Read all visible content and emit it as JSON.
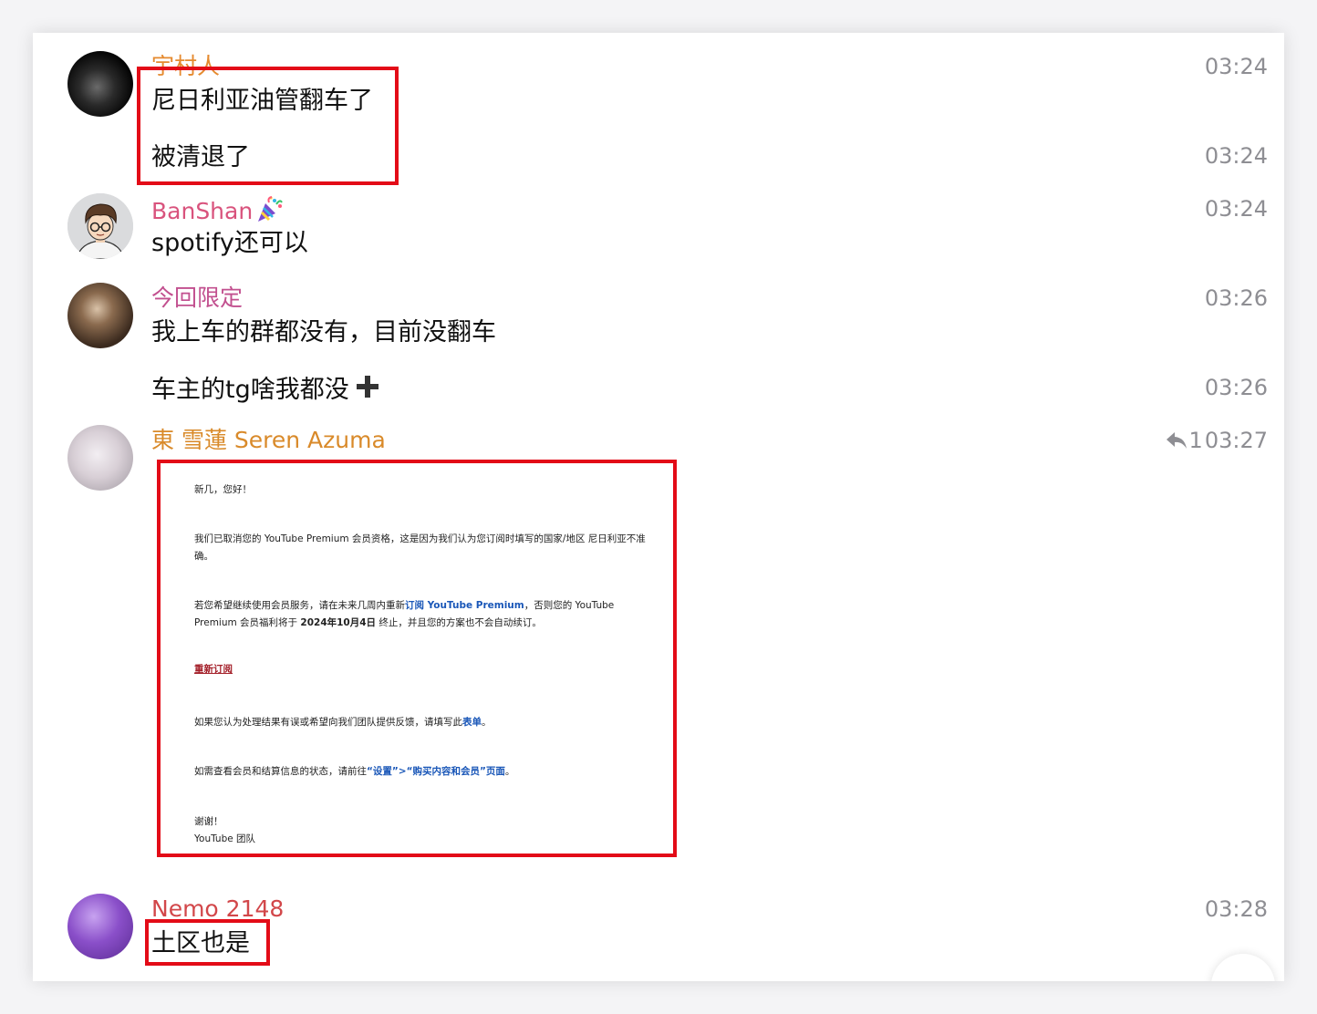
{
  "messages": [
    {
      "sender": "宇村人",
      "sender_color": "#e58a2f",
      "lines": [
        {
          "text": "尼日利亚油管翻车了",
          "time": "03:24"
        },
        {
          "text": "被清退了",
          "time": "03:24"
        }
      ]
    },
    {
      "sender": "BanShan",
      "sender_color": "#d9537d",
      "lines": [
        {
          "text": "spotify还可以",
          "time": "03:24"
        }
      ]
    },
    {
      "sender": "今回限定",
      "sender_color": "#c2508f",
      "lines": [
        {
          "text": "我上车的群都没有，目前没翻车",
          "time": "03:26"
        },
        {
          "text": "车主的tg啥我都没",
          "time": "03:26"
        }
      ]
    },
    {
      "sender": "東 雪蓮 Seren Azuma",
      "sender_color": "#d98a2a",
      "time": "03:27",
      "reply_count": "1",
      "email": {
        "greeting": "新几，您好！",
        "p1": "我们已取消您的 YouTube Premium 会员资格，这是因为我们认为您订阅时填写的国家/地区 尼日利亚不准确。",
        "p2_a": "若您希望继续使用会员服务，请在未来几周内重新",
        "p2_link": "订阅 YouTube Premium",
        "p2_b": "，否则您的 YouTube Premium 会员福利将于 ",
        "p2_date": "2024年10月4日",
        "p2_c": " 终止，并且您的方案也不会自动续订。",
        "resubscribe": "重新订阅",
        "p3_a": "如果您认为处理结果有误或希望向我们团队提供反馈，请填写此",
        "p3_link": "表单",
        "p3_b": "。",
        "p4_a": "如需查看会员和结算信息的状态，请前往",
        "p4_link": "“设置”>“购买内容和会员”页面",
        "p4_b": "。",
        "thanks": "谢谢！",
        "signature": "YouTube 团队"
      }
    },
    {
      "sender": "Nemo 2148",
      "sender_color": "#d2474a",
      "lines": [
        {
          "text": "土区也是",
          "time": "03:28"
        }
      ]
    }
  ],
  "colors": {
    "highlight_box": "#e30b17",
    "time_text": "#8e8e93",
    "link_blue": "#1a57b8"
  },
  "icons": [
    "plus-icon",
    "reply-icon",
    "party-emoji-icon"
  ]
}
